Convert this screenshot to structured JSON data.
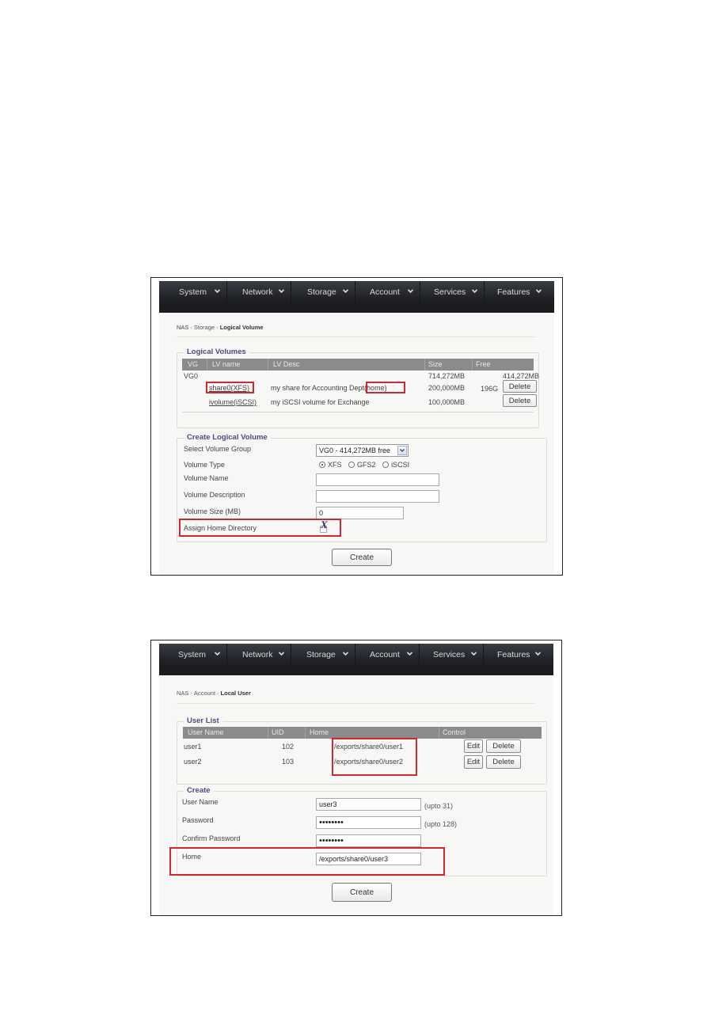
{
  "nav": {
    "items": [
      "System",
      "Network",
      "Storage",
      "Account",
      "Services",
      "Features"
    ]
  },
  "screen1": {
    "breadcrumb": {
      "root": "NAS",
      "section": "Storage",
      "current": "Logical Volume"
    },
    "logical_volumes": {
      "legend": "Logical Volumes",
      "columns": [
        "VG",
        "LV name",
        "LV Desc",
        "Size",
        "Free"
      ],
      "group": {
        "vg": "VG0",
        "size": "714,272MB",
        "free": "414,272MB"
      },
      "rows": [
        {
          "name": "share0(XFS)",
          "desc": "my share for Accounting Dept(home)",
          "size": "200,000MB",
          "free": "196G",
          "action": "Delete",
          "highlighted": true
        },
        {
          "name": "ivolume(iSCSI)",
          "desc": "my iSCSI volume for Exchange",
          "size": "100,000MB",
          "free": "",
          "action": "Delete",
          "highlighted": false
        }
      ]
    },
    "create": {
      "legend": "Create Logical Volume",
      "fields": {
        "vg_label": "Select Volume Group",
        "vg_value": "VG0 - 414,272MB free",
        "type_label": "Volume Type",
        "type_options": [
          "XFS",
          "GFS2",
          "iSCSI"
        ],
        "type_selected": "XFS",
        "name_label": "Volume Name",
        "name_value": "",
        "desc_label": "Volume Description",
        "desc_value": "",
        "size_label": "Volume Size (MB)",
        "size_value": "0",
        "home_label": "Assign Home Directory",
        "home_checked": true,
        "home_mark": "X"
      },
      "button": "Create"
    }
  },
  "screen2": {
    "breadcrumb": {
      "root": "NAS",
      "section": "Account",
      "current": "Local User"
    },
    "user_list": {
      "legend": "User List",
      "columns": [
        "User Name",
        "UID",
        "Home",
        "Control"
      ],
      "rows": [
        {
          "user": "user1",
          "uid": "102",
          "home": "/exports/share0/user1",
          "edit": "Edit",
          "delete": "Delete"
        },
        {
          "user": "user2",
          "uid": "103",
          "home": "/exports/share0/user2",
          "edit": "Edit",
          "delete": "Delete"
        }
      ]
    },
    "create": {
      "legend": "Create",
      "fields": {
        "username_label": "User Name",
        "username_value": "user3",
        "username_hint": "(upto 31)",
        "password_label": "Password",
        "password_value": "password",
        "password_hint": "(upto 128)",
        "confirm_label": "Confirm Password",
        "confirm_value": "password",
        "home_label": "Home",
        "home_value": "/exports/share0/user3"
      },
      "button": "Create"
    }
  },
  "colors": {
    "highlight": "#cc2a32",
    "legend_text": "#4a4a86",
    "navbar": "#1f2126",
    "table_header": "#8b8b8b"
  }
}
